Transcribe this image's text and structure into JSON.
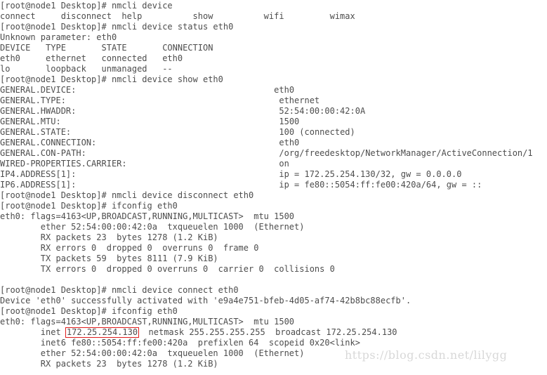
{
  "terminal": {
    "prompt": "[root@node1 Desktop]# ",
    "background_color": "#ffffff",
    "text_color": "#4d4d4d",
    "highlight_border_color": "#e01b1b",
    "highlighted_value": "172.25.254.130"
  },
  "watermark": {
    "text": "https://blog.csdn.net/lilygg",
    "color": "#d8d8d8"
  },
  "lines": {
    "l01": "[root@node1 Desktop]# nmcli device",
    "l02": "connect     disconnect  help          show          wifi         wimax",
    "l03": "[root@node1 Desktop]# nmcli device status eth0",
    "l04": "Unknown parameter: eth0",
    "l05": "DEVICE   TYPE       STATE       CONNECTION",
    "l06": "eth0     ethernet   connected   eth0",
    "l07": "lo       loopback   unmanaged   --",
    "l08": "[root@node1 Desktop]# nmcli device show eth0",
    "l09a": "GENERAL.DEVICE:",
    "l09b": "eth0",
    "l10a": "GENERAL.TYPE:",
    "l10b": "ethernet",
    "l11a": "GENERAL.HWADDR:",
    "l11b": "52:54:00:00:42:0A",
    "l12a": "GENERAL.MTU:",
    "l12b": "1500",
    "l13a": "GENERAL.STATE:",
    "l13b": "100 (connected)",
    "l14a": "GENERAL.CONNECTION:",
    "l14b": "eth0",
    "l15a": "GENERAL.CON-PATH:",
    "l15b": "/org/freedesktop/NetworkManager/ActiveConnection/1",
    "l16a": "WIRED-PROPERTIES.CARRIER:",
    "l16b": "on",
    "l17a": "IP4.ADDRESS[1]:",
    "l17b": "ip = 172.25.254.130/32, gw = 0.0.0.0",
    "l18a": "IP6.ADDRESS[1]:",
    "l18b": "ip = fe80::5054:ff:fe00:420a/64, gw = ::",
    "l19": "[root@node1 Desktop]# nmcli device disconnect eth0",
    "l20": "[root@node1 Desktop]# ifconfig eth0",
    "l21": "eth0: flags=4163<UP,BROADCAST,RUNNING,MULTICAST>  mtu 1500",
    "l22": "        ether 52:54:00:00:42:0a  txqueuelen 1000  (Ethernet)",
    "l23": "        RX packets 23  bytes 1278 (1.2 KiB)",
    "l24": "        RX errors 0  dropped 0  overruns 0  frame 0",
    "l25": "        TX packets 59  bytes 8111 (7.9 KiB)",
    "l26": "        TX errors 0  dropped 0 overruns 0  carrier 0  collisions 0",
    "l27": "",
    "l28": "[root@node1 Desktop]# nmcli device connect eth0",
    "l29": "Device 'eth0' successfully activated with 'e9a4e751-bfeb-4d05-af74-42b8bc88ecfb'.",
    "l30": "[root@node1 Desktop]# ifconfig eth0",
    "l31": "eth0: flags=4163<UP,BROADCAST,RUNNING,MULTICAST>  mtu 1500",
    "l32a": "        inet ",
    "l32b": "172.25.254.130",
    "l32c": "  netmask 255.255.255.255  broadcast 172.25.254.130",
    "l33": "        inet6 fe80::5054:ff:fe00:420a  prefixlen 64  scopeid 0x20<link>",
    "l34": "        ether 52:54:00:00:42:0a  txqueuelen 1000  (Ethernet)",
    "l35": "        RX packets 23  bytes 1278 (1.2 KiB)"
  }
}
